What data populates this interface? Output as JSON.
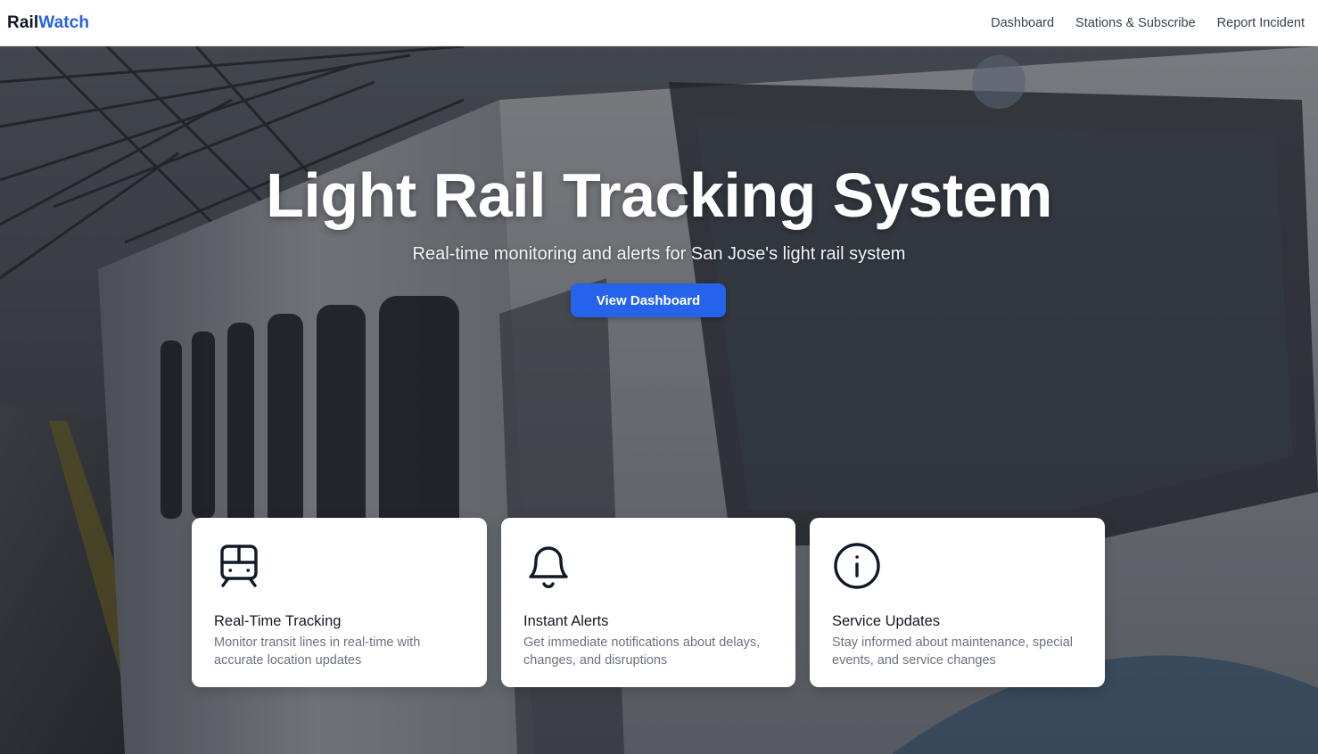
{
  "brand": {
    "part1": "Rail",
    "part2": "Watch"
  },
  "nav": {
    "items": [
      {
        "label": "Dashboard"
      },
      {
        "label": "Stations & Subscribe"
      },
      {
        "label": "Report Incident"
      }
    ]
  },
  "hero": {
    "title": "Light Rail Tracking System",
    "subtitle": "Real-time monitoring and alerts for San Jose's light rail system",
    "cta_label": "View Dashboard"
  },
  "features": [
    {
      "icon": "train-icon",
      "title": "Real-Time Tracking",
      "description": "Monitor transit lines in real-time with accurate location updates"
    },
    {
      "icon": "bell-icon",
      "title": "Instant Alerts",
      "description": "Get immediate notifications about delays, changes, and disruptions"
    },
    {
      "icon": "info-icon",
      "title": "Service Updates",
      "description": "Stay informed about maintenance, special events, and service changes"
    }
  ],
  "colors": {
    "accent": "#2563eb",
    "text": "#111827",
    "muted": "#6b7280"
  }
}
